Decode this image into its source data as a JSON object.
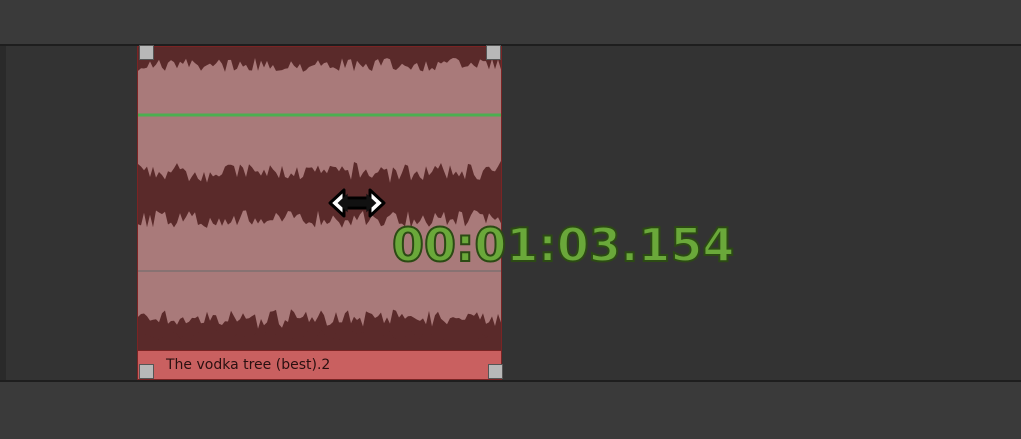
{
  "timeline": {
    "clip": {
      "name": "The vodka tree (best).2"
    },
    "timecode": "00:01:03.154",
    "cursor": "resize-horizontal-icon"
  },
  "colors": {
    "background": "#3a3a3a",
    "track": "#333333",
    "clip_body": "#a97a7a",
    "clip_waveform": "#5a2a2a",
    "clip_label_bar": "#c96060",
    "volume_line": "#4caf50",
    "timecode": "#6aa83a"
  }
}
